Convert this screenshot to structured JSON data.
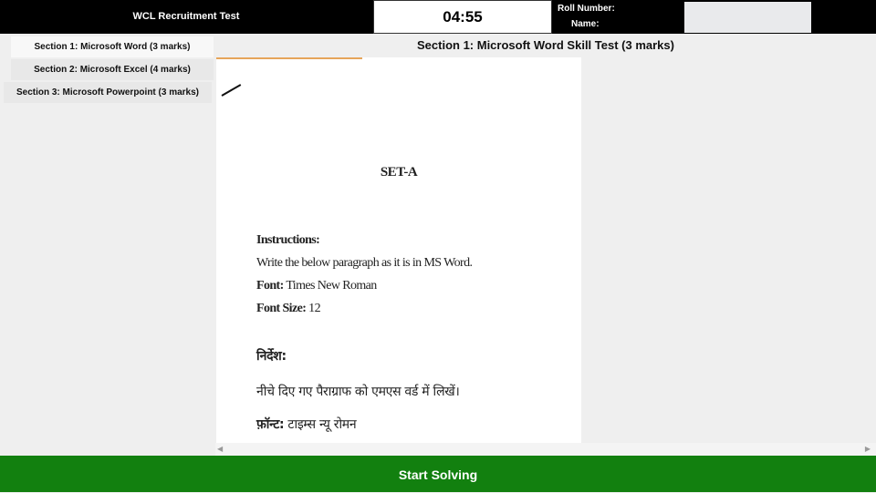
{
  "header": {
    "app_title": "WCL Recruitment Test",
    "timer": "04:55",
    "roll_label": "Roll Number:",
    "name_label": "Name:"
  },
  "sidebar": {
    "items": [
      {
        "label": "Section 1: Microsoft Word (3 marks)"
      },
      {
        "label": "Section 2: Microsoft Excel (4 marks)"
      },
      {
        "label": "Section 3: Microsoft Powerpoint (3 marks)"
      }
    ]
  },
  "main": {
    "section_title": "Section 1: Microsoft Word Skill Test (3 marks)",
    "document": {
      "title": "SET-A",
      "instructions_heading": "Instructions:",
      "instruction_line": "Write the below paragraph as it is in MS Word.",
      "font_label": "Font:",
      "font_value": " Times New Roman",
      "size_label": "Font Size:",
      "size_value": " 12",
      "hindi_heading": "निर्देश:",
      "hindi_instruction": "नीचे दिए गए पैराग्राफ को एमएस वर्ड में लिखें।",
      "hindi_font_label": "फ़ॉन्ट:",
      "hindi_font_value": " टाइम्स न्यू रोमन"
    }
  },
  "footer": {
    "start_label": "Start Solving"
  },
  "colors": {
    "header_bg": "#000000",
    "start_button_bg": "#12800f"
  }
}
